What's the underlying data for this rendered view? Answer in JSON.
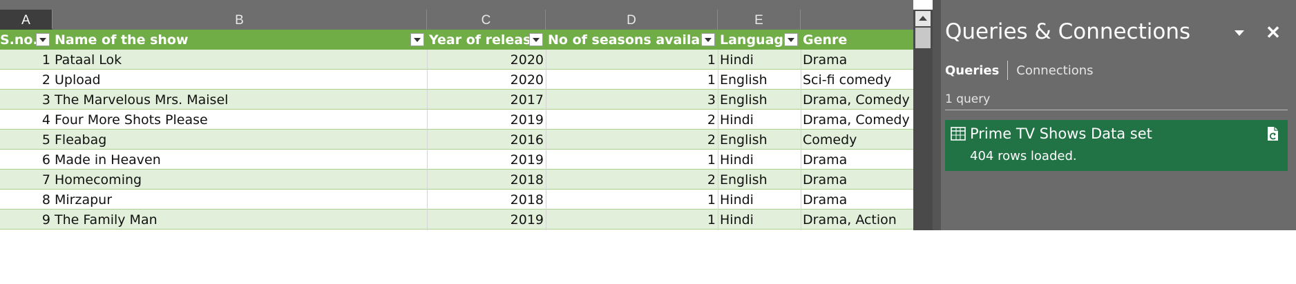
{
  "columns": [
    "A",
    "B",
    "C",
    "D",
    "E"
  ],
  "table": {
    "headers": [
      "S.no.",
      "Name of the show",
      "Year of release",
      "No of seasons available",
      "Language",
      "Genre"
    ],
    "rows": [
      [
        "1",
        "Pataal Lok",
        "2020",
        "1",
        "Hindi",
        "Drama"
      ],
      [
        "2",
        "Upload",
        "2020",
        "1",
        "English",
        "Sci-fi comedy"
      ],
      [
        "3",
        "The Marvelous Mrs. Maisel",
        "2017",
        "3",
        "English",
        "Drama, Comedy"
      ],
      [
        "4",
        "Four More Shots Please",
        "2019",
        "2",
        "Hindi",
        "Drama, Comedy"
      ],
      [
        "5",
        "Fleabag",
        "2016",
        "2",
        "English",
        "Comedy"
      ],
      [
        "6",
        "Made in Heaven",
        "2019",
        "1",
        "Hindi",
        "Drama"
      ],
      [
        "7",
        "Homecoming",
        "2018",
        "2",
        "English",
        "Drama"
      ],
      [
        "8",
        "Mirzapur",
        "2018",
        "1",
        "Hindi",
        "Drama"
      ],
      [
        "9",
        "The Family Man",
        "2019",
        "1",
        "Hindi",
        "Drama, Action"
      ]
    ]
  },
  "pane": {
    "title": "Queries & Connections",
    "close_label": "✕",
    "tabs": [
      "Queries",
      "Connections"
    ],
    "query_count": "1 query",
    "query": {
      "name": "Prime TV Shows Data set",
      "status": "404 rows loaded."
    }
  },
  "colors": {
    "table_header": "#70ad47",
    "band": "#e2efda",
    "query_card": "#217346",
    "pane": "#6b6b6b"
  },
  "icons": [
    "chevron-down-icon",
    "close-icon",
    "table-icon",
    "refresh-icon",
    "filter-dropdown-icon"
  ]
}
